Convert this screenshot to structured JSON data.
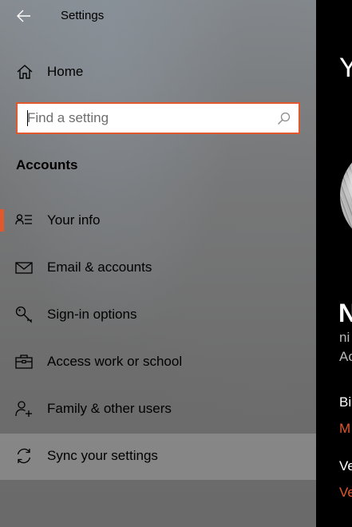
{
  "window": {
    "title": "Settings"
  },
  "sidebar": {
    "home_label": "Home",
    "search": {
      "placeholder": "Find a setting",
      "value": ""
    },
    "section_header": "Accounts",
    "items": [
      {
        "label": "Your info",
        "icon": "person-info-icon",
        "selected": true
      },
      {
        "label": "Email & accounts",
        "icon": "mail-icon",
        "selected": false
      },
      {
        "label": "Sign-in options",
        "icon": "key-icon",
        "selected": false
      },
      {
        "label": "Access work or school",
        "icon": "briefcase-icon",
        "selected": false
      },
      {
        "label": "Family & other users",
        "icon": "person-add-icon",
        "selected": false
      },
      {
        "label": "Sync your settings",
        "icon": "sync-icon",
        "selected": false,
        "hovered": true
      }
    ]
  },
  "content": {
    "heading": "Y",
    "user_name": "N",
    "user_email": "ni",
    "user_type": "Ac",
    "billing_heading": "Bi",
    "billing_link": "M",
    "verify_heading": "Ve",
    "verify_link": "Ve"
  },
  "colors": {
    "accent": "#e0582b",
    "sidebar_background": "#767778",
    "content_background": "#000000"
  }
}
